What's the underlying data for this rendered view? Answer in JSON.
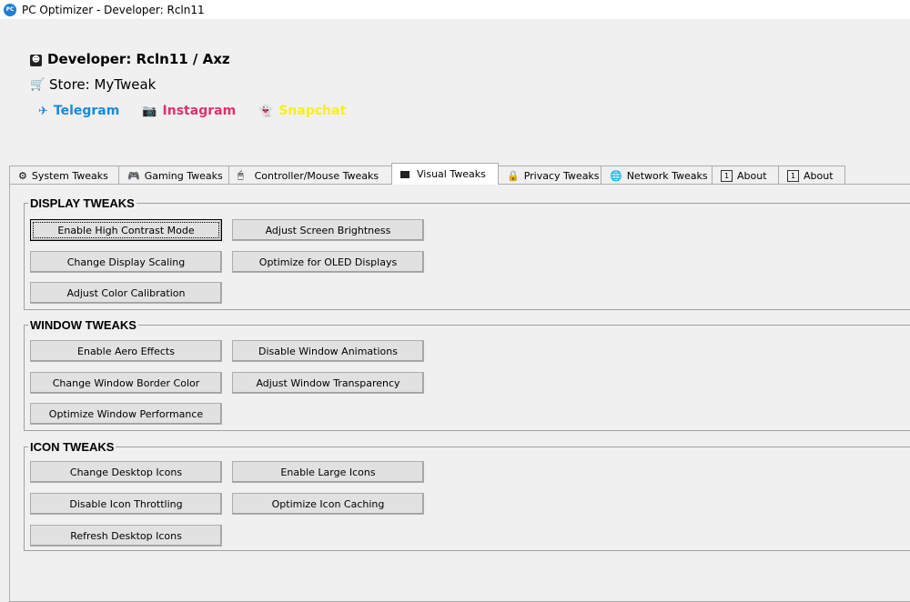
{
  "window": {
    "title": "PC Optimizer - Developer: Rcln11",
    "icon": "app-icon"
  },
  "header": {
    "developer": "Developer: Rcln11 / Axz",
    "store": "Store: MyTweak",
    "socials": [
      {
        "label": "Telegram",
        "color": "#1c8ad8",
        "icon": "telegram-icon"
      },
      {
        "label": "Instagram",
        "color": "#e0316b",
        "icon": "instagram-icon"
      },
      {
        "label": "Snapchat",
        "color": "#f7f01a",
        "icon": "snapchat-icon"
      }
    ]
  },
  "tabs": [
    {
      "label": "System Tweaks",
      "icon": "gear-icon"
    },
    {
      "label": "Gaming Tweaks",
      "icon": "gamepad-icon"
    },
    {
      "label": "Controller/Mouse Tweaks",
      "icon": "mouse-icon"
    },
    {
      "label": "Visual Tweaks",
      "icon": "visual-icon",
      "active": true
    },
    {
      "label": "Privacy Tweaks",
      "icon": "lock-icon"
    },
    {
      "label": "Network Tweaks",
      "icon": "globe-icon"
    },
    {
      "label": "About",
      "icon": "info-icon"
    },
    {
      "label": "About",
      "icon": "info-icon"
    }
  ],
  "groups": [
    {
      "title": "DISPLAY TWEAKS",
      "buttons": [
        "Enable High Contrast Mode",
        "Adjust Screen Brightness",
        "Change Display Scaling",
        "Optimize for OLED Displays",
        "Adjust Color Calibration"
      ]
    },
    {
      "title": "WINDOW TWEAKS",
      "buttons": [
        "Enable Aero Effects",
        "Disable Window Animations",
        "Change Window Border Color",
        "Adjust Window Transparency",
        "Optimize Window Performance"
      ]
    },
    {
      "title": "ICON TWEAKS",
      "buttons": [
        "Change Desktop Icons",
        "Enable Large Icons",
        "Disable Icon Throttling",
        "Optimize Icon Caching",
        "Refresh Desktop Icons"
      ]
    }
  ]
}
